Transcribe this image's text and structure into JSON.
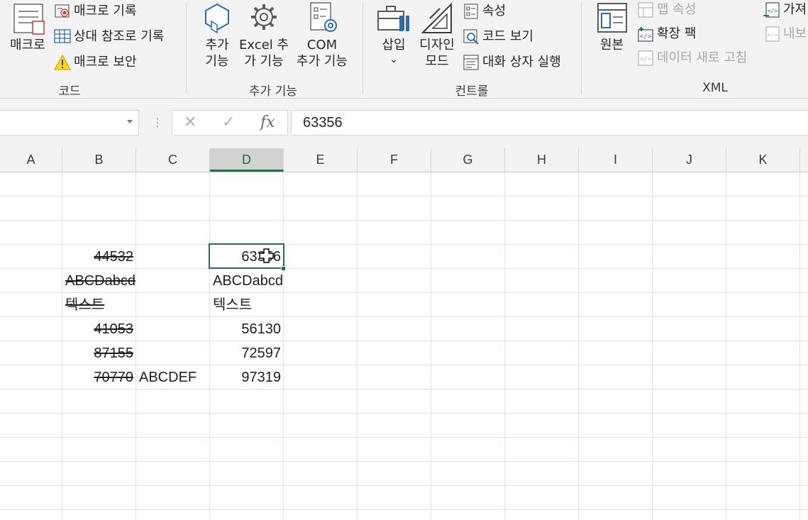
{
  "ribbon": {
    "code": {
      "group_label": "코드",
      "macros_label": "매크로",
      "record_macro": "매크로 기록",
      "relative_refs": "상대 참조로 기록",
      "macro_security": "매크로 보안"
    },
    "addins": {
      "group_label": "추가 기능",
      "addins_line1": "추가",
      "addins_line2": "기능",
      "excel_addins_line1": "Excel 추",
      "excel_addins_line2": "가 기능",
      "com_addins_line1": "COM",
      "com_addins_line2": "추가 기능"
    },
    "controls": {
      "group_label": "컨트롤",
      "insert_label": "삽입",
      "insert_arrow": "⌄",
      "design_mode_line1": "디자인",
      "design_mode_line2": "모드",
      "properties": "속성",
      "view_code": "코드 보기",
      "run_dialog": "대화 상자 실행"
    },
    "xml": {
      "group_label": "XML",
      "source_label": "원본",
      "map_properties": "맵 속성",
      "expansion_packs": "확장 팩",
      "refresh_data": "데이터 새로 고침",
      "import": "가져",
      "export": "내보"
    }
  },
  "formula_bar": {
    "grip": "⋮",
    "cancel": "✕",
    "enter": "✓",
    "fx": "fx",
    "value": "63356"
  },
  "columns": [
    "A",
    "B",
    "C",
    "D",
    "E",
    "F",
    "G",
    "H",
    "I",
    "J",
    "K"
  ],
  "selected_column": "D",
  "cells": {
    "B4": "44532",
    "D4": "63356",
    "B5": "ABCDabcd",
    "D5": "ABCDabcd",
    "B6": "텍스트",
    "D6": "텍스트",
    "B7": "41053",
    "D7": "56130",
    "B8": "87155",
    "D8": "72597",
    "B9": "70770",
    "C9": "ABCDEF",
    "D9": "97319"
  },
  "colors": {
    "accent_green": "#217346",
    "ribbon_bg": "#f3f3f3",
    "grid_line": "#e1e1e1",
    "icon_blue": "#2b6cb0",
    "icon_red": "#d13438"
  }
}
